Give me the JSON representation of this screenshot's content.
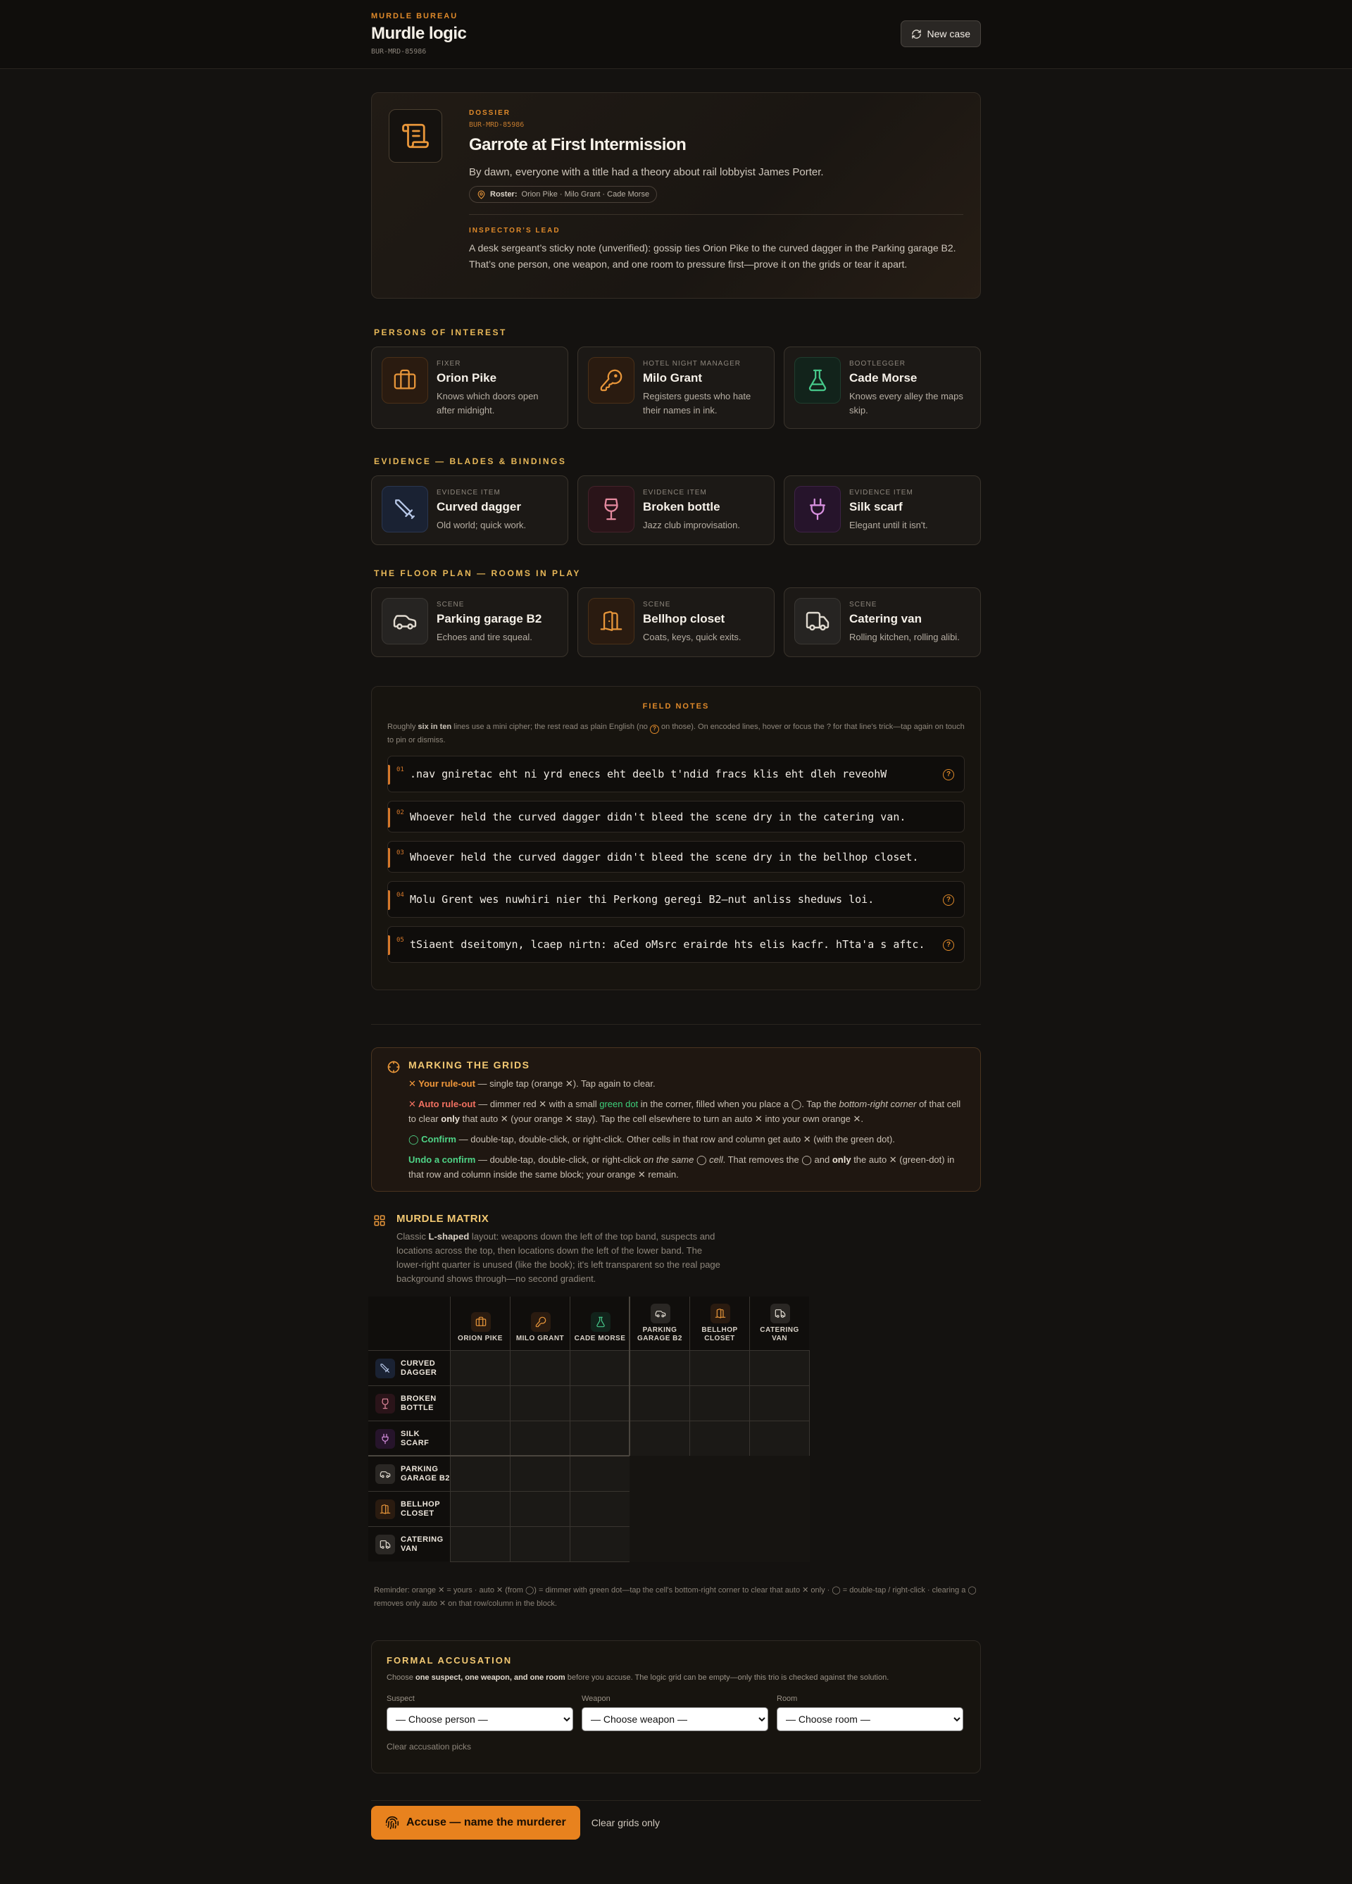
{
  "header": {
    "bureau": "MURDLE BUREAU",
    "title": "Murdle logic",
    "case_id": "BUR-MRD-85986",
    "new_case_label": "New case"
  },
  "dossier": {
    "kicker": "DOSSIER",
    "case_id": "BUR-MRD-85986",
    "title": "Garrote at First Intermission",
    "lede": "By dawn, everyone with a title had a theory about rail lobbyist James Porter.",
    "roster_label": "Roster:",
    "roster_names": "Orion Pike · Milo Grant · Cade Morse",
    "lead_kicker": "INSPECTOR’S LEAD",
    "lead_text": "A desk sergeant’s sticky note (unverified): gossip ties Orion Pike to the curved dagger in the Parking garage B2. That’s one person, one weapon, and one room to pressure first—prove it on the grids or tear it apart."
  },
  "suspects": {
    "title": "PERSONS OF INTEREST",
    "items": [
      {
        "role": "FIXER",
        "name": "Orion Pike",
        "desc": "Knows which doors open after midnight.",
        "icon": "briefcase-icon",
        "color": "#e8963a"
      },
      {
        "role": "HOTEL NIGHT MANAGER",
        "name": "Milo Grant",
        "desc": "Registers guests who hate their names in ink.",
        "icon": "key-icon",
        "color": "#e8963a"
      },
      {
        "role": "BOOTLEGGER",
        "name": "Cade Morse",
        "desc": "Knows every alley the maps skip.",
        "icon": "flask-icon",
        "color": "#46c88a"
      }
    ]
  },
  "weapons": {
    "title": "EVIDENCE — BLADES & BINDINGS",
    "items": [
      {
        "role": "EVIDENCE ITEM",
        "name": "Curved dagger",
        "desc": "Old world; quick work.",
        "icon": "dagger-icon",
        "color": "#9ab0d8"
      },
      {
        "role": "EVIDENCE ITEM",
        "name": "Broken bottle",
        "desc": "Jazz club improvisation.",
        "icon": "wine-glass-icon",
        "color": "#e58aa0"
      },
      {
        "role": "EVIDENCE ITEM",
        "name": "Silk scarf",
        "desc": "Elegant until it isn't.",
        "icon": "scarf-icon",
        "color": "#d890e0"
      }
    ]
  },
  "rooms": {
    "title": "THE FLOOR PLAN — ROOMS IN PLAY",
    "items": [
      {
        "role": "SCENE",
        "name": "Parking garage B2",
        "desc": "Echoes and tire squeal.",
        "icon": "car-icon",
        "color": "#d8d2c8"
      },
      {
        "role": "SCENE",
        "name": "Bellhop closet",
        "desc": "Coats, keys, quick exits.",
        "icon": "door-icon",
        "color": "#e8963a"
      },
      {
        "role": "SCENE",
        "name": "Catering van",
        "desc": "Rolling kitchen, rolling alibi.",
        "icon": "truck-icon",
        "color": "#d8d2c8"
      }
    ]
  },
  "notes": {
    "kicker": "FIELD NOTES",
    "intro_a": "Roughly ",
    "intro_b": "six in ten",
    "intro_c": " lines use a mini cipher; the rest read as plain English (no ",
    "intro_d": " on those). On encoded lines, hover or focus the ? for that line's trick—tap again on touch to pin or dismiss.",
    "hint_glyph": "?",
    "items": [
      {
        "num": "01",
        "text": ".nav gniretac eht ni yrd enecs eht deelb t'ndid fracs klis eht dleh reveohW",
        "encoded": true
      },
      {
        "num": "02",
        "text": "Whoever held the curved dagger didn't bleed the scene dry in the catering van.",
        "encoded": false
      },
      {
        "num": "03",
        "text": "Whoever held the curved dagger didn't bleed the scene dry in the bellhop closet.",
        "encoded": false
      },
      {
        "num": "04",
        "text": "Molu Grent wes nuwhiri nier thi Perkong geregi B2—nut anliss sheduws loi.",
        "encoded": true
      },
      {
        "num": "05",
        "text": "tSiaent dseitomyn, lcaep nirtn: aCed oMsrc erairde hts elis kacfr. hTta'a s aftc.",
        "encoded": true
      }
    ]
  },
  "marking": {
    "title": "MARKING THE GRIDS",
    "r1_label": "✕ Your rule-out",
    "r1_text": " — single tap (orange ✕). Tap again to clear.",
    "r2_label": "✕ Auto rule-out",
    "r2_a": " — dimmer red ✕ with a small ",
    "r2_green": "green dot",
    "r2_b": " in the corner, filled when you place a ◯. Tap the ",
    "r2_i": "bottom-right corner",
    "r2_c": " of that cell to clear ",
    "r2_only": "only",
    "r2_d": " that auto ✕ (your orange ✕ stay). Tap the cell elsewhere to turn an auto ✕ into your own orange ✕.",
    "r3_label": "◯ Confirm",
    "r3_text": " — double-tap, double-click, or right-click. Other cells in that row and column get auto ✕ (with the green dot).",
    "r4_label": "Undo a confirm",
    "r4_a": " — double-tap, double-click, or right-click ",
    "r4_i": "on the same ◯ cell",
    "r4_b": ". That removes the ◯ and ",
    "r4_only": "only",
    "r4_c": " the auto ✕ (green-dot) in that row and column inside the same block; your orange ✕ remain."
  },
  "matrix": {
    "title": "MURDLE MATRIX",
    "desc_a": "Classic ",
    "desc_b": "L-shaped",
    "desc_c": " layout: weapons down the left of the top band, suspects and locations across the top, then locations down the left of the lower band. The lower-right quarter is unused (like the book); it's left transparent so the real page background shows through—no second gradient.",
    "columns": [
      "ORION PIKE",
      "MILO GRANT",
      "CADE MORSE",
      "PARKING GARAGE B2",
      "BELLHOP CLOSET",
      "CATERING VAN"
    ],
    "rows": [
      "CURVED DAGGER",
      "BROKEN BOTTLE",
      "SILK SCARF",
      "PARKING GARAGE B2",
      "BELLHOP CLOSET",
      "CATERING VAN"
    ],
    "reminder": "Reminder: orange ✕ = yours · auto ✕ (from ◯) = dimmer with green dot—tap the cell's bottom-right corner to clear that auto ✕ only · ◯ = double-tap / right-click · clearing a ◯ removes only auto ✕ on that row/column in the block."
  },
  "accusation": {
    "title": "FORMAL ACCUSATION",
    "desc_a": "Choose ",
    "desc_b": "one suspect, one weapon, and one room",
    "desc_c": " before you accuse. The logic grid can be empty—only this trio is checked against the solution.",
    "suspect_label": "Suspect",
    "suspect_value": "— Choose person —",
    "weapon_label": "Weapon",
    "weapon_value": "— Choose weapon —",
    "room_label": "Room",
    "room_value": "— Choose room —",
    "clear_label": "Clear accusation picks"
  },
  "footer": {
    "accuse_label": "Accuse — name the murderer",
    "clear_grids_label": "Clear grids only"
  }
}
